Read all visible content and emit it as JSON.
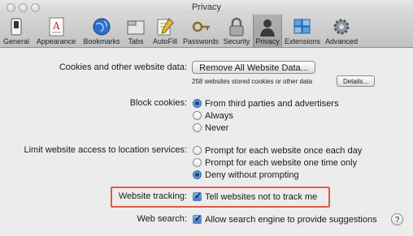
{
  "window": {
    "title": "Privacy"
  },
  "toolbar": {
    "items": [
      {
        "label": "General",
        "icon": "general-switch-icon"
      },
      {
        "label": "Appearance",
        "icon": "appearance-font-icon"
      },
      {
        "label": "Bookmarks",
        "icon": "bookmarks-globe-icon"
      },
      {
        "label": "Tabs",
        "icon": "tabs-icon"
      },
      {
        "label": "AutoFill",
        "icon": "autofill-pencil-icon"
      },
      {
        "label": "Passwords",
        "icon": "passwords-key-icon"
      },
      {
        "label": "Security",
        "icon": "security-lock-icon"
      },
      {
        "label": "Privacy",
        "icon": "privacy-silhouette-icon",
        "selected": true
      },
      {
        "label": "Extensions",
        "icon": "extensions-puzzle-icon"
      },
      {
        "label": "Advanced",
        "icon": "advanced-gear-icon"
      }
    ]
  },
  "cookies": {
    "label": "Cookies and other website data:",
    "remove_button": "Remove All Website Data...",
    "stored_note": "258 websites stored cookies or other data",
    "details_button": "Details..."
  },
  "block_cookies": {
    "label": "Block cookies:",
    "options": [
      "From third parties and advertisers",
      "Always",
      "Never"
    ],
    "selected": "From third parties and advertisers"
  },
  "location": {
    "label": "Limit website access to location services:",
    "options": [
      "Prompt for each website once each day",
      "Prompt for each website one time only",
      "Deny without prompting"
    ],
    "selected": "Deny without prompting"
  },
  "tracking": {
    "label": "Website tracking:",
    "option": "Tell websites not to track me",
    "checked": true
  },
  "search": {
    "label": "Web search:",
    "option": "Allow search engine to provide suggestions",
    "checked": true
  },
  "help": {
    "label": "?"
  },
  "colors": {
    "highlight": "#e05a4a",
    "radio_selected": "#3a79cc"
  }
}
